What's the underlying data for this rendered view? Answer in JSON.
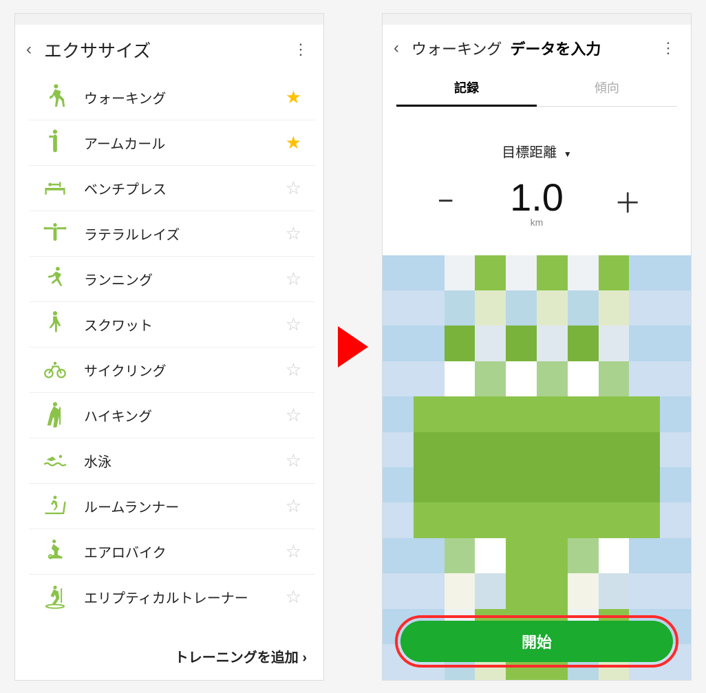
{
  "left": {
    "title": "エクササイズ",
    "items": [
      {
        "label": "ウォーキング",
        "starred": true,
        "icon": "walk"
      },
      {
        "label": "アームカール",
        "starred": true,
        "icon": "armcurl"
      },
      {
        "label": "ベンチプレス",
        "starred": false,
        "icon": "bench"
      },
      {
        "label": "ラテラルレイズ",
        "starred": false,
        "icon": "lateral"
      },
      {
        "label": "ランニング",
        "starred": false,
        "icon": "run"
      },
      {
        "label": "スクワット",
        "starred": false,
        "icon": "squat"
      },
      {
        "label": "サイクリング",
        "starred": false,
        "icon": "cycle"
      },
      {
        "label": "ハイキング",
        "starred": false,
        "icon": "hike"
      },
      {
        "label": "水泳",
        "starred": false,
        "icon": "swim"
      },
      {
        "label": "ルームランナー",
        "starred": false,
        "icon": "treadmill"
      },
      {
        "label": "エアロバイク",
        "starred": false,
        "icon": "ergbike"
      },
      {
        "label": "エリプティカルトレーナー",
        "starred": false,
        "icon": "elliptical"
      }
    ],
    "add_training": "トレーニングを追加"
  },
  "right": {
    "back_label": "ウォーキング",
    "header_strong": "データを入力",
    "tabs": {
      "record": "記録",
      "trend": "傾向"
    },
    "target_label": "目標距離",
    "value": "1.0",
    "unit": "km",
    "minus": "−",
    "plus": "＋",
    "start": "開始"
  }
}
